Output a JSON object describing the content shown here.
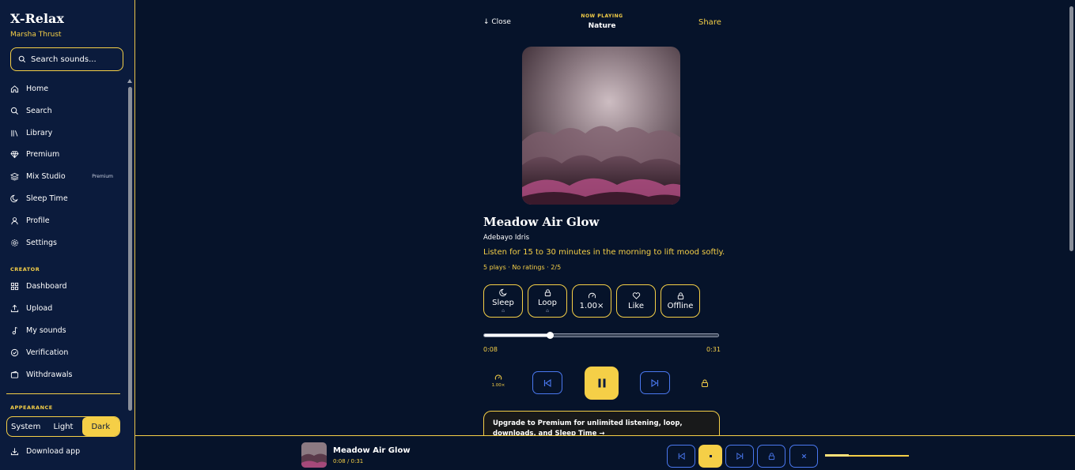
{
  "app": {
    "title": "X-Relax",
    "user": "Marsha Thrust"
  },
  "search": {
    "placeholder": "Search sounds..."
  },
  "nav": [
    {
      "label": "Home",
      "icon": "home-icon"
    },
    {
      "label": "Search",
      "icon": "search-icon"
    },
    {
      "label": "Library",
      "icon": "library-icon"
    },
    {
      "label": "Premium",
      "icon": "diamond-icon"
    },
    {
      "label": "Mix Studio",
      "icon": "layers-icon",
      "badge": "Premium"
    },
    {
      "label": "Sleep Time",
      "icon": "moon-icon"
    },
    {
      "label": "Profile",
      "icon": "user-icon"
    },
    {
      "label": "Settings",
      "icon": "gear-icon"
    }
  ],
  "creator": {
    "section": "CREATOR",
    "items": [
      {
        "label": "Dashboard",
        "icon": "dashboard-icon"
      },
      {
        "label": "Upload",
        "icon": "upload-icon"
      },
      {
        "label": "My sounds",
        "icon": "music-note-icon"
      },
      {
        "label": "Verification",
        "icon": "check-circle-icon"
      },
      {
        "label": "Withdrawals",
        "icon": "wallet-icon"
      }
    ]
  },
  "appearance": {
    "section": "APPEARANCE",
    "options": [
      "System",
      "Light",
      "Dark"
    ],
    "selected": "Dark"
  },
  "download": {
    "label": "Download app"
  },
  "player": {
    "close_label": "↓ Close",
    "now_playing_label": "NOW PLAYING",
    "category": "Nature",
    "share_label": "Share",
    "title": "Meadow Air Glow",
    "artist": "Adebayo Idris",
    "description": "Listen for 15 to 30 minutes in the morning to lift mood softly.",
    "meta": "5 plays · No ratings · 2/5",
    "chips": [
      {
        "label": "Sleep",
        "icon": "moon-icon",
        "locked": true
      },
      {
        "label": "Loop",
        "icon": "lock-icon",
        "locked": true
      },
      {
        "label": "1.00×",
        "icon": "speed-icon",
        "locked": false
      },
      {
        "label": "Like",
        "icon": "heart-icon",
        "locked": false
      },
      {
        "label": "Offline",
        "icon": "lock-icon",
        "locked": false
      }
    ],
    "current_time": "0:08",
    "duration": "0:31",
    "progress": 0.28,
    "speed": "1.00×",
    "upgrade_text": "Upgrade to Premium for unlimited listening, loop, downloads, and Sleep Time →"
  },
  "mini": {
    "title": "Meadow Air Glow",
    "time": "0:08 / 0:31",
    "volume": 0.28
  },
  "colors": {
    "accent": "#f5cf47",
    "sidebar_bg": "#0b1b3c",
    "main_bg": "#06132a",
    "control_border": "#4a78f0"
  }
}
